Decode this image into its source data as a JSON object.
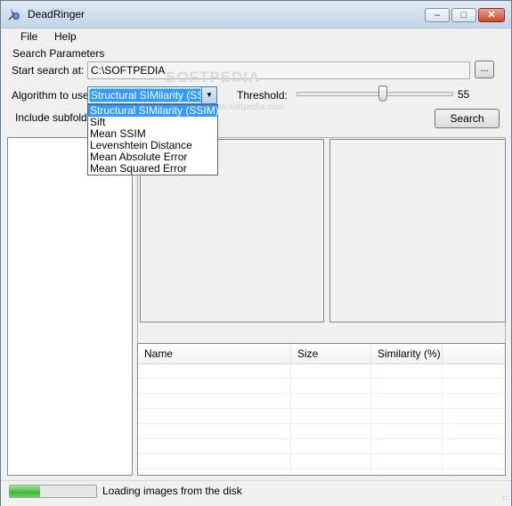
{
  "window": {
    "title": "DeadRinger"
  },
  "menu": [
    "File",
    "Help"
  ],
  "search_params": {
    "group_label": "Search Parameters",
    "start_label": "Start search at:",
    "start_value": "C:\\SOFTPEDIA",
    "browse_label": "...",
    "algorithm_label": "Algorithm to use:",
    "algorithm_selected": "Structural SIMilarity (SSIM)",
    "algorithm_options": [
      "Structural SIMilarity (SSIM)",
      "Sift",
      "Mean SSIM",
      "Levenshtein Distance",
      "Mean Absolute Error",
      "Mean Squared Error"
    ],
    "threshold_label": "Threshold:",
    "threshold_value": "55",
    "threshold_level": 0.55,
    "include_subfolders_label": "Include subfolder",
    "search_button": "Search"
  },
  "watermark": {
    "main": "SOFTPEDIA",
    "sub": "www.softpedia.com"
  },
  "results": {
    "columns": [
      "Name",
      "Size",
      "Similarity (%)"
    ]
  },
  "status": {
    "text": "Loading images from the disk",
    "progress": 0.35
  },
  "icons": {
    "app": "app-icon",
    "minimize": "minimize-icon",
    "maximize": "maximize-icon",
    "close": "close-icon",
    "dropdown": "chevron-down-icon",
    "grip": "resize-grip-icon"
  }
}
